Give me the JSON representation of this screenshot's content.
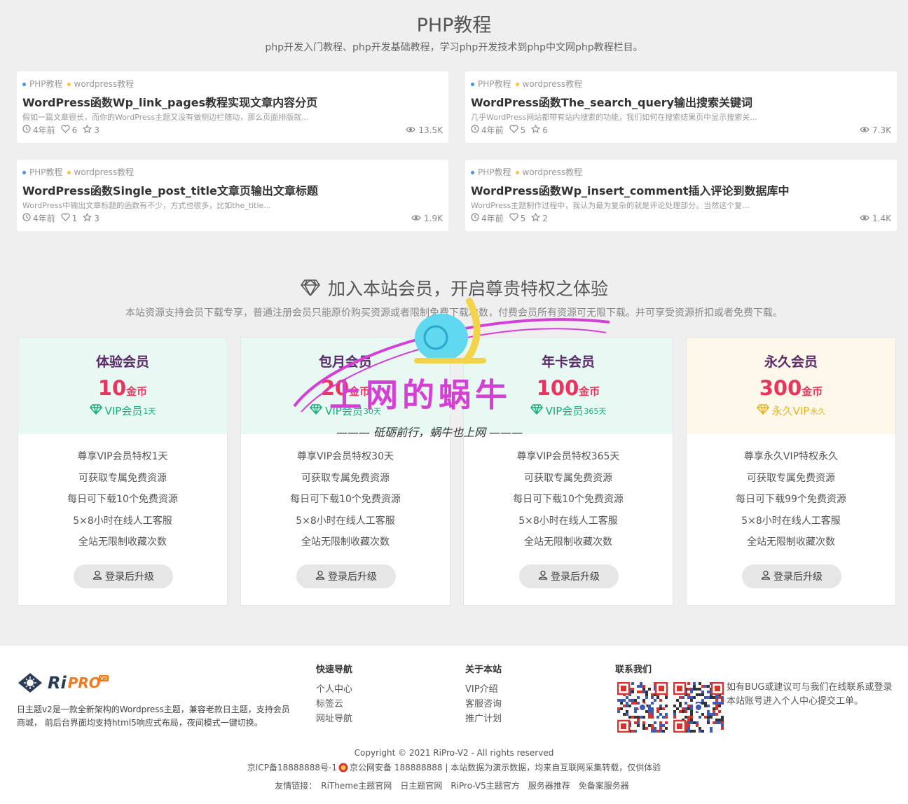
{
  "php_section": {
    "title": "PHP教程",
    "subtitle": "php开发入门教程、php开发基础教程，学习php开发技术到php中文网php教程栏目。",
    "posts": [
      {
        "cat1": "PHP教程",
        "cat2": "wordpress教程",
        "title": "WordPress函数Wp_link_pages教程实现文章内容分页",
        "excerpt": "假如一篇文章很长，而你的WordPress主题又没有做侧边栏随动，那么页面排版就...",
        "time": "4年前",
        "likes": "6",
        "stars": "3",
        "views": "13.5K"
      },
      {
        "cat1": "PHP教程",
        "cat2": "wordpress教程",
        "title": "WordPress函数The_search_query输出搜索关键词",
        "excerpt": "几乎WordPress网站都带有站内搜索的功能，我们如何在搜索结果页中显示搜索关...",
        "time": "4年前",
        "likes": "5",
        "stars": "6",
        "views": "7.3K"
      },
      {
        "cat1": "PHP教程",
        "cat2": "wordpress教程",
        "title": "WordPress函数Single_post_title文章页输出文章标题",
        "excerpt": "WordPress中输出文章标题的函数有不少，方式也很多，比如the_title...",
        "time": "4年前",
        "likes": "1",
        "stars": "3",
        "views": "1.9K"
      },
      {
        "cat1": "PHP教程",
        "cat2": "wordpress教程",
        "title": "WordPress函数Wp_insert_comment插入评论到数据库中",
        "excerpt": " WordPress主题制作过程中，我认为最为复杂的就是评论处理部分。当然这个复...",
        "time": "4年前",
        "likes": "5",
        "stars": "2",
        "views": "1.4K"
      }
    ]
  },
  "vip_section": {
    "title": "加入本站会员，开启尊贵特权之体验",
    "subtitle": "本站资源支持会员下载专享，普通注册会员只能原价购买资源或者限制免费下载次数，付费会员所有资源可无限下载。并可享受资源折扣或者免费下载。",
    "cards": [
      {
        "name": "体验会员",
        "price": "10",
        "unit": "金币",
        "badge": "VIP会员",
        "badge_sup": "1天",
        "perks": [
          "尊享VIP会员特权1天",
          "可获取专属免费资源",
          "每日可下载10个免费资源",
          "5×8小时在线人工客服",
          "全站无限制收藏次数"
        ],
        "button": "登录后升级"
      },
      {
        "name": "包月会员",
        "price": "20",
        "unit": "金币",
        "badge": "VIP会员",
        "badge_sup": "30天",
        "perks": [
          "尊享VIP会员特权30天",
          "可获取专属免费资源",
          "每日可下载10个免费资源",
          "5×8小时在线人工客服",
          "全站无限制收藏次数"
        ],
        "button": "登录后升级"
      },
      {
        "name": "年卡会员",
        "price": "100",
        "unit": "金币",
        "badge": "VIP会员",
        "badge_sup": "365天",
        "perks": [
          "尊享VIP会员特权365天",
          "可获取专属免费资源",
          "每日可下载10个免费资源",
          "5×8小时在线人工客服",
          "全站无限制收藏次数"
        ],
        "button": "登录后升级"
      },
      {
        "name": "永久会员",
        "price": "300",
        "unit": "金币",
        "badge": "永久VIP",
        "badge_sup": "永久",
        "perks": [
          "尊享永久VIP特权永久",
          "可获取专属免费资源",
          "每日可下载99个免费资源",
          "5×8小时在线人工客服",
          "全站无限制收藏次数"
        ],
        "button": "登录后升级"
      }
    ]
  },
  "watermark": {
    "main": "上网的蜗牛",
    "sub": "——— 砥砺前行，蜗牛也上网 ———"
  },
  "footer": {
    "logo_ri": "Ri",
    "logo_pro": "PRO",
    "logo_badge": "V5",
    "description": "日主题v2是一款全新架构的Wordpress主题，兼容老款日主题，支持会员商城， 前后台界面均支持html5响应式布局，夜间模式一键切换。",
    "nav_title": "快速导航",
    "nav_links": [
      "个人中心",
      "标签云",
      "网址导航"
    ],
    "about_title": "关于本站",
    "about_links": [
      "VIP介绍",
      "客服咨询",
      "推广计划"
    ],
    "contact_title": "联系我们",
    "contact_text": "如有BUG或建议可与我们在线联系或登录本站账号进入个人中心提交工单。",
    "copyright": "Copyright © 2021 RiPro-V2 - All rights reserved",
    "icp_left": "京ICP备18888888号-1",
    "icp_right": "京公网安备 188888888 | 本站数据为演示数据，均来自互联网采集转载，仅供体验",
    "links_label": "友情链接：",
    "links": [
      "RiTheme主题官网",
      "日主题官网",
      "RiPro-V5主题官方",
      "服务器推荐",
      "免备案服务器"
    ]
  },
  "colors": {
    "price": "#e8345e",
    "vip_green": "#1aab7b",
    "vip_gold": "#e6b422",
    "card_top_green": "#e8f8f3",
    "card_top_gold": "#fdf8ea"
  }
}
